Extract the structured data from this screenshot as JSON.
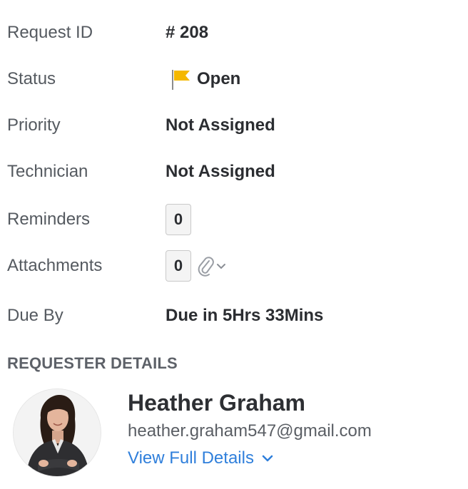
{
  "details": {
    "request_id": {
      "label": "Request ID",
      "value": "# 208"
    },
    "status": {
      "label": "Status",
      "value": "Open",
      "flag_color": "#f5b800"
    },
    "priority": {
      "label": "Priority",
      "value": "Not Assigned"
    },
    "technician": {
      "label": "Technician",
      "value": "Not Assigned"
    },
    "reminders": {
      "label": "Reminders",
      "count": "0"
    },
    "attachments": {
      "label": "Attachments",
      "count": "0"
    },
    "due_by": {
      "label": "Due By",
      "value": "Due in 5Hrs 33Mins"
    }
  },
  "requester": {
    "section_title": "REQUESTER DETAILS",
    "name": "Heather Graham",
    "email": "heather.graham547@gmail.com",
    "view_details_label": "View Full Details"
  },
  "colors": {
    "link": "#2f7fdb",
    "flag": "#f5b800"
  }
}
